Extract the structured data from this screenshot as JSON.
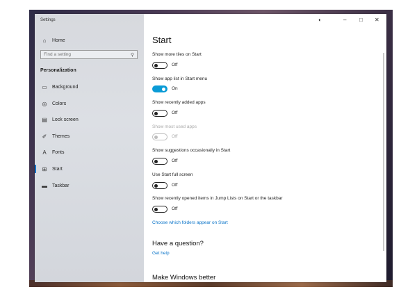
{
  "window": {
    "title": "Settings"
  },
  "sidebar": {
    "home": "Home",
    "search_placeholder": "Find a setting",
    "section": "Personalization",
    "items": [
      {
        "label": "Background",
        "icon": "image-icon",
        "glyph": "▭"
      },
      {
        "label": "Colors",
        "icon": "palette-icon",
        "glyph": "◎"
      },
      {
        "label": "Lock screen",
        "icon": "lock-screen-icon",
        "glyph": "▤"
      },
      {
        "label": "Themes",
        "icon": "themes-icon",
        "glyph": "✐"
      },
      {
        "label": "Fonts",
        "icon": "fonts-icon",
        "glyph": "A"
      },
      {
        "label": "Start",
        "icon": "start-icon",
        "glyph": "⊞",
        "active": true
      },
      {
        "label": "Taskbar",
        "icon": "taskbar-icon",
        "glyph": "▬"
      }
    ]
  },
  "main": {
    "title": "Start",
    "settings": [
      {
        "label": "Show more tiles on Start",
        "state": "Off",
        "on": false,
        "disabled": false
      },
      {
        "label": "Show app list in Start menu",
        "state": "On",
        "on": true,
        "disabled": false
      },
      {
        "label": "Show recently added apps",
        "state": "Off",
        "on": false,
        "disabled": false
      },
      {
        "label": "Show most used apps",
        "state": "Off",
        "on": false,
        "disabled": true
      },
      {
        "label": "Show suggestions occasionally in Start",
        "state": "Off",
        "on": false,
        "disabled": false
      },
      {
        "label": "Use Start full screen",
        "state": "Off",
        "on": false,
        "disabled": false
      },
      {
        "label": "Show recently opened items in Jump Lists on Start or the taskbar",
        "state": "Off",
        "on": false,
        "disabled": false
      }
    ],
    "folders_link": "Choose which folders appear on Start",
    "question_heading": "Have a question?",
    "help_link": "Get help",
    "better_heading": "Make Windows better"
  },
  "colors": {
    "accent": "#0a9bd6",
    "link": "#0a74c9"
  }
}
